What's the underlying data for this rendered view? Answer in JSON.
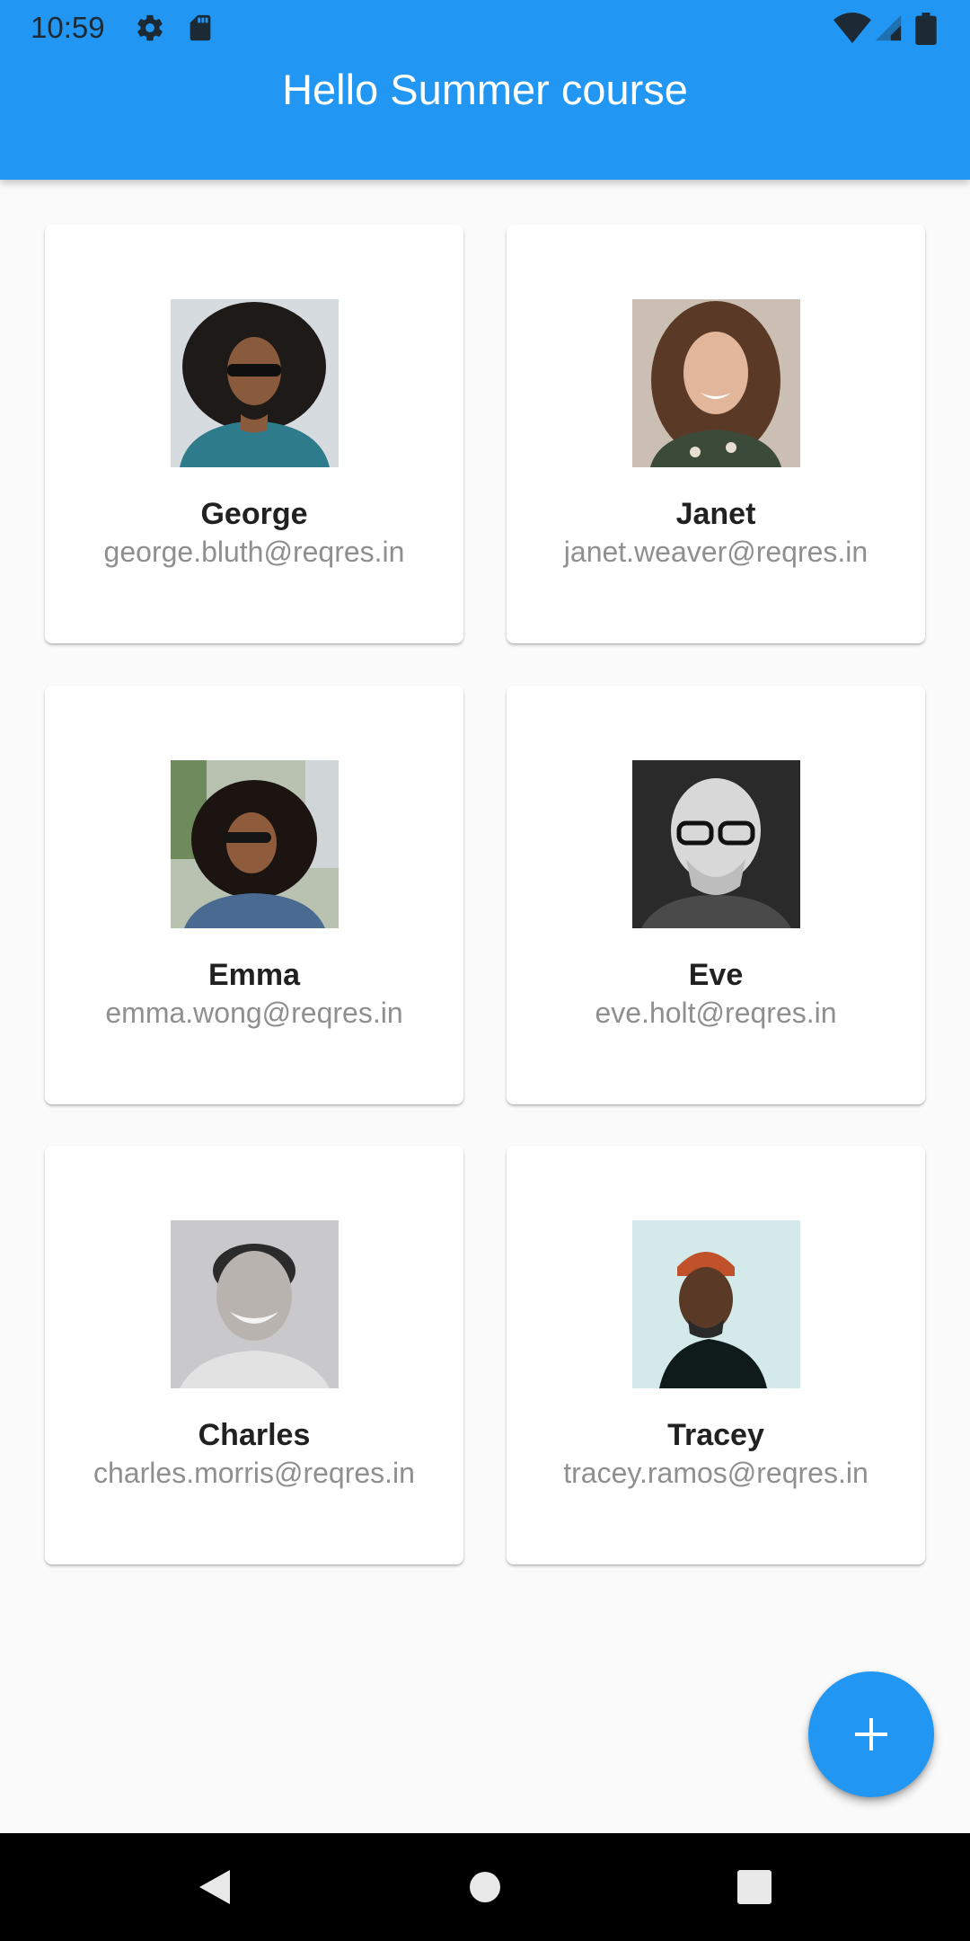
{
  "status_bar": {
    "time": "10:59",
    "left_icons": [
      "gear-icon",
      "sd-card-icon"
    ],
    "right_icons": [
      "wifi-icon",
      "cell-signal-icon",
      "battery-icon"
    ]
  },
  "app_bar": {
    "title": "Hello Summer course",
    "color": "#2196f3"
  },
  "users": [
    {
      "name": "George",
      "email": "george.bluth@reqres.in",
      "avatar": "george-avatar"
    },
    {
      "name": "Janet",
      "email": "janet.weaver@reqres.in",
      "avatar": "janet-avatar"
    },
    {
      "name": "Emma",
      "email": "emma.wong@reqres.in",
      "avatar": "emma-avatar"
    },
    {
      "name": "Eve",
      "email": "eve.holt@reqres.in",
      "avatar": "eve-avatar"
    },
    {
      "name": "Charles",
      "email": "charles.morris@reqres.in",
      "avatar": "charles-avatar"
    },
    {
      "name": "Tracey",
      "email": "tracey.ramos@reqres.in",
      "avatar": "tracey-avatar"
    }
  ],
  "fab": {
    "icon": "add-icon",
    "color": "#2196f3"
  },
  "nav_bar": {
    "buttons": [
      "back-icon",
      "home-icon",
      "recents-icon"
    ]
  }
}
